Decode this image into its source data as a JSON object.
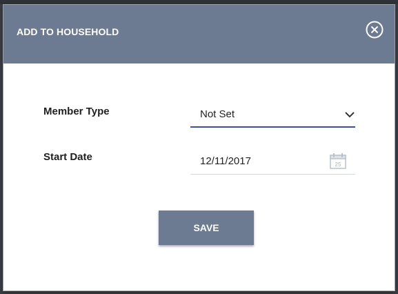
{
  "dialog": {
    "title": "ADD TO HOUSEHOLD",
    "close_icon": "close-circle-icon"
  },
  "form": {
    "member_type": {
      "label": "Member Type",
      "value": "Not Set",
      "icon": "chevron-down-icon"
    },
    "start_date": {
      "label": "Start Date",
      "value": "12/11/2017",
      "icon": "calendar-icon",
      "calendar_icon_day": "25"
    }
  },
  "actions": {
    "save_label": "SAVE"
  },
  "colors": {
    "header_bg": "#6c7a92",
    "button_bg": "#6c7a92",
    "focus_underline": "#3f4fa0"
  }
}
